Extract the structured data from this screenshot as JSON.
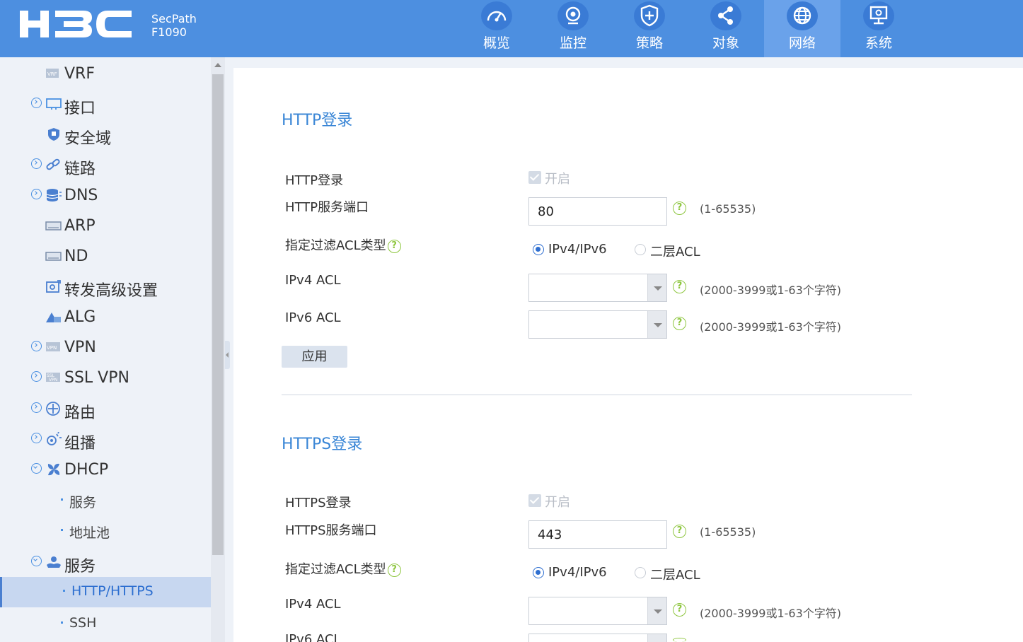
{
  "header": {
    "product_name": "SecPath",
    "product_model": "F1090",
    "nav": [
      {
        "label": "概览",
        "icon": "gauge-icon"
      },
      {
        "label": "监控",
        "icon": "camera-icon"
      },
      {
        "label": "策略",
        "icon": "shield-plus-icon"
      },
      {
        "label": "对象",
        "icon": "share-nodes-icon"
      },
      {
        "label": "网络",
        "icon": "globe-icon",
        "active": true
      },
      {
        "label": "系统",
        "icon": "monitor-gear-icon"
      }
    ]
  },
  "sidebar": {
    "items": [
      {
        "label": "VRF",
        "icon": "vrf-icon"
      },
      {
        "label": "接口",
        "icon": "interface-icon"
      },
      {
        "label": "安全域",
        "icon": "security-zone-icon"
      },
      {
        "label": "链路",
        "icon": "link-icon"
      },
      {
        "label": "DNS",
        "icon": "database-icon"
      },
      {
        "label": "ARP",
        "icon": "arp-icon"
      },
      {
        "label": "ND",
        "icon": "nd-icon"
      },
      {
        "label": "转发高级设置",
        "icon": "forward-settings-icon"
      },
      {
        "label": "ALG",
        "icon": "alg-icon"
      },
      {
        "label": "VPN",
        "icon": "vpn-icon"
      },
      {
        "label": "SSL VPN",
        "icon": "ssl-vpn-icon"
      },
      {
        "label": "路由",
        "icon": "route-icon"
      },
      {
        "label": "组播",
        "icon": "multicast-icon"
      },
      {
        "label": "DHCP",
        "icon": "dhcp-icon"
      },
      {
        "label": "服务"
      },
      {
        "label": "地址池"
      },
      {
        "label": "服务",
        "icon": "service-icon"
      },
      {
        "label": "HTTP/HTTPS",
        "selected": true
      },
      {
        "label": "SSH"
      }
    ]
  },
  "http": {
    "title": "HTTP登录",
    "login_label": "HTTP登录",
    "enable_label": "开启",
    "port_label": "HTTP服务端口",
    "port_value": "80",
    "port_range": "(1-65535)",
    "acl_type_label": "指定过滤ACL类型",
    "acl_type_options": [
      "IPv4/IPv6",
      "二层ACL"
    ],
    "ipv4_acl_label": "IPv4 ACL",
    "ipv6_acl_label": "IPv6 ACL",
    "acl_hint": "(2000-3999或1-63个字符)",
    "apply_label": "应用"
  },
  "https": {
    "title": "HTTPS登录",
    "login_label": "HTTPS登录",
    "enable_label": "开启",
    "port_label": "HTTPS服务端口",
    "port_value": "443",
    "port_range": "(1-65535)",
    "acl_type_label": "指定过滤ACL类型",
    "acl_type_options": [
      "IPv4/IPv6",
      "二层ACL"
    ],
    "ipv4_acl_label": "IPv4 ACL",
    "ipv6_acl_label": "IPv6 ACL",
    "acl_hint": "(2000-3999或1-63个字符)"
  },
  "colors": {
    "header_bg": "#4d8fe0",
    "active_nav_bg": "#6aa2ea",
    "accent": "#3a86d6",
    "help_green": "#8ec63f"
  }
}
